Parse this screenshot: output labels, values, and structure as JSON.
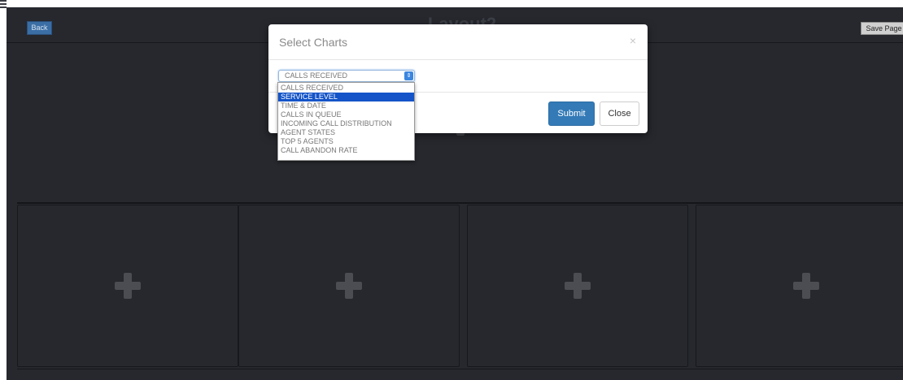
{
  "app": {
    "back_label": "Back",
    "layout_title": "Layout2",
    "save_label": "Save Page"
  },
  "tiles": [
    {
      "icon": "plus-icon"
    },
    {
      "icon": "plus-icon"
    },
    {
      "icon": "plus-icon"
    },
    {
      "icon": "plus-icon"
    }
  ],
  "modal": {
    "title": "Select Charts",
    "close_symbol": "×",
    "select_value": "CALLS RECEIVED",
    "submit_label": "Submit",
    "close_label": "Close",
    "options": [
      "CALLS RECEIVED",
      "SERVICE LEVEL",
      "TIME & DATE",
      "CALLS IN QUEUE",
      "INCOMING CALL DISTRIBUTION",
      "AGENT STATES",
      "TOP 5 AGENTS",
      "CALL ABANDON RATE"
    ],
    "highlighted_option": "SERVICE LEVEL"
  },
  "colors": {
    "background": "#26282e",
    "primary": "#337ab7",
    "highlight": "#1454c8"
  }
}
